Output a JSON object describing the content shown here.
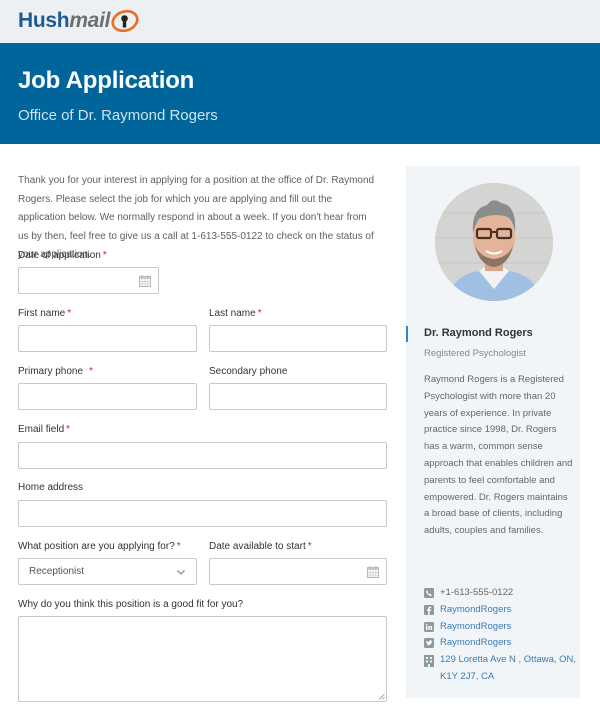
{
  "brand": {
    "logo_part1": "Hush",
    "logo_part2": "mail",
    "colors": {
      "brand_blue": "#1e5b94",
      "banner_blue": "#00659b",
      "logo_orange": "#e86e25",
      "required_red": "#c0272d",
      "link_blue": "#3a7bb8"
    }
  },
  "banner": {
    "title": "Job Application",
    "subtitle": "Office of Dr. Raymond Rogers"
  },
  "intro": "Thank you for your interest in applying for a position at the office of Dr. Raymond Rogers. Please select the job for which you are applying and fill out the application below. We normally respond in about a week. If you don't hear from us by then, feel free to give us a call at 1-613-555-0122 to check on the status of your application.",
  "form": {
    "required_mark": "*",
    "date_of_application": {
      "label": "Date of application",
      "value": "",
      "icon": "calendar-icon"
    },
    "first_name": {
      "label": "First name",
      "value": ""
    },
    "last_name": {
      "label": "Last name",
      "value": ""
    },
    "primary_phone": {
      "label": "Primary phone",
      "value": ""
    },
    "secondary_phone": {
      "label": "Secondary phone",
      "value": ""
    },
    "email": {
      "label": "Email field",
      "value": ""
    },
    "home_address": {
      "label": "Home address",
      "value": ""
    },
    "position": {
      "label": "What position are you applying for?",
      "selected": "Receptionist",
      "icon": "chevron-down-icon"
    },
    "date_available": {
      "label": "Date available to start",
      "value": "",
      "icon": "calendar-icon"
    },
    "why_fit": {
      "label": "Why do you think this position is a good fit for you?",
      "value": ""
    }
  },
  "profile": {
    "name": "Dr. Raymond Rogers",
    "role": "Registered Psychologist",
    "bio": "Raymond Rogers is a Registered Psychologist with more than 20 years of experience. In private practice since 1998, Dr. Rogers has a warm, common sense approach that enables children and parents to feel comfortable and empowered. Dr. Rogers maintains a broad base of clients, including adults, couples and families.",
    "contacts": [
      {
        "icon": "phone-icon",
        "text": "+1-613-555-0122"
      },
      {
        "icon": "facebook-icon",
        "text": "RaymondRogers"
      },
      {
        "icon": "linkedin-icon",
        "text": "RaymondRogers"
      },
      {
        "icon": "twitter-icon",
        "text": "RaymondRogers"
      },
      {
        "icon": "building-icon",
        "text": "129 Loretta Ave N , Ottawa, ON, K1Y 2J7, CA"
      }
    ]
  }
}
